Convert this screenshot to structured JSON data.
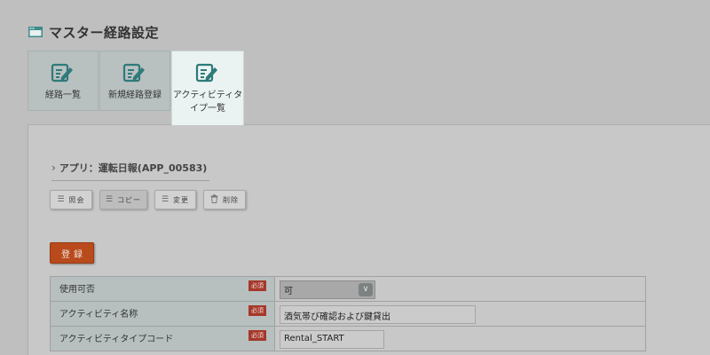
{
  "header": {
    "title": "マスター経路設定",
    "icon": "window-icon"
  },
  "tabs": [
    {
      "label": "経路一覧",
      "icon": "edit-document-icon",
      "active": false
    },
    {
      "label": "新規経路登録",
      "icon": "edit-document-icon",
      "active": false
    },
    {
      "label_line1": "アクティビティタ",
      "label_line2": "イプ一覧",
      "icon": "edit-document-icon",
      "active": true
    }
  ],
  "app": {
    "title": "アプリ：運転日報(APP_00583)"
  },
  "actions": {
    "inquiry": "照会",
    "copy": "コピー",
    "change": "変更",
    "delete": "削除"
  },
  "register": {
    "label": "登録"
  },
  "form": {
    "required_badge": "必須",
    "rows": {
      "availability": {
        "label": "使用可否",
        "value": "可"
      },
      "activity_name": {
        "label": "アクティビティ名称",
        "value": "酒気帯び確認および鍵貸出"
      },
      "activity_type_code": {
        "label": "アクティビティタイプコード",
        "value": "Rental_START"
      }
    }
  },
  "colors": {
    "background": "#bfbfbf",
    "active_tab": "#eaf2f2",
    "register_button": "#b84a1c",
    "required_badge": "#a5382a",
    "label_cell": "#b7bfbf"
  }
}
